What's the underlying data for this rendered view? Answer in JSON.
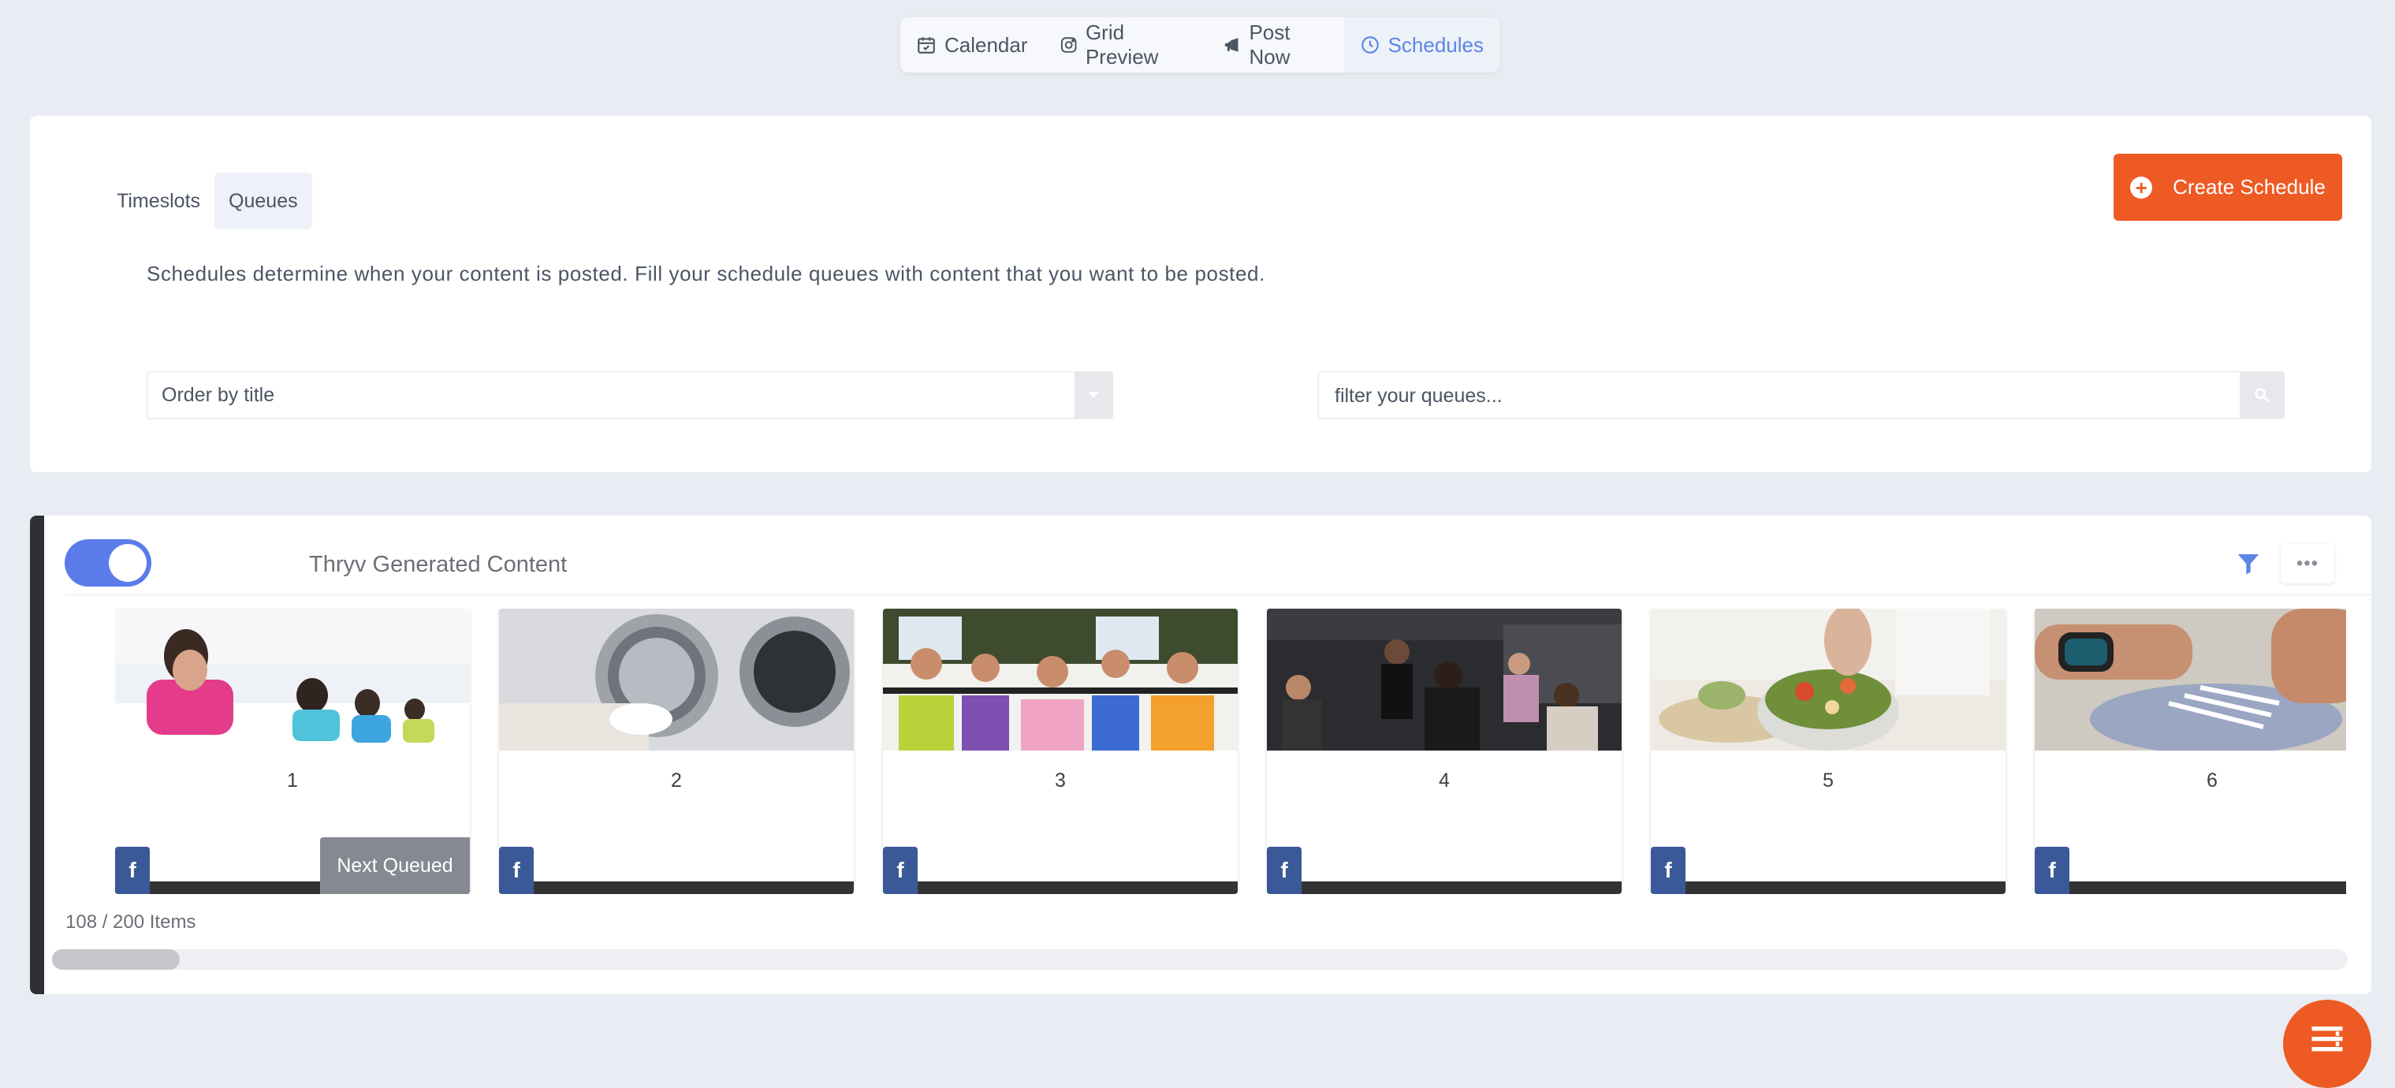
{
  "nav": {
    "items": [
      {
        "label": "Calendar",
        "icon": "calendar-check-icon",
        "active": false
      },
      {
        "label": "Grid Preview",
        "icon": "instagram-icon",
        "active": false
      },
      {
        "label": "Post Now",
        "icon": "megaphone-icon",
        "active": false
      },
      {
        "label": "Schedules",
        "icon": "clock-icon",
        "active": true
      }
    ]
  },
  "tabs": [
    {
      "label": "Timeslots",
      "active": false
    },
    {
      "label": "Queues",
      "active": true
    }
  ],
  "create_button": {
    "label": "Create Schedule",
    "icon": "plus-circle-icon"
  },
  "description": "Schedules determine when your content is posted. Fill your schedule queues with content that you want to be posted.",
  "order_select": {
    "value": "Order by title"
  },
  "filter": {
    "placeholder": "filter your queues..."
  },
  "queue": {
    "title": "Thryv Generated Content",
    "enabled": true,
    "posts": [
      {
        "number": "1",
        "network": "facebook",
        "badge": "Next Queued"
      },
      {
        "number": "2",
        "network": "facebook"
      },
      {
        "number": "3",
        "network": "facebook"
      },
      {
        "number": "4",
        "network": "facebook"
      },
      {
        "number": "5",
        "network": "facebook"
      },
      {
        "number": "6",
        "network": "facebook"
      }
    ],
    "items_count": "108 / 200 Items"
  },
  "colors": {
    "accent": "#5b86e5",
    "orange": "#ee5a24",
    "facebook": "#3b5998",
    "toggle_on": "#5b7bea"
  }
}
